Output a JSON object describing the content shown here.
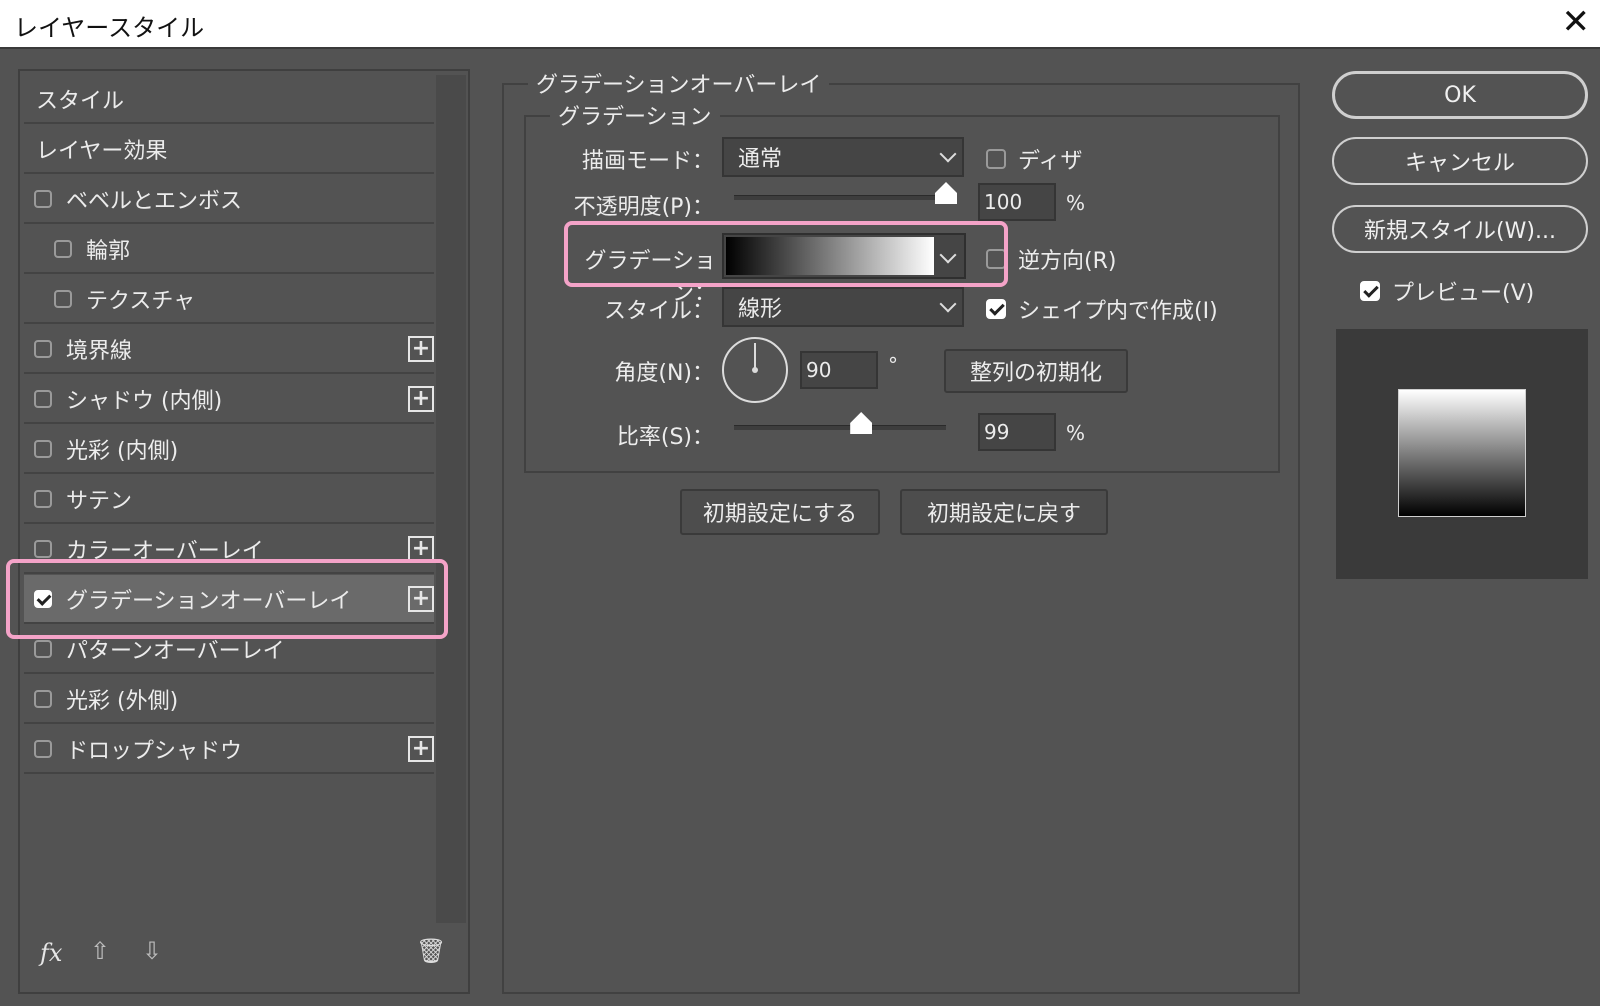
{
  "window": {
    "title": "レイヤースタイル",
    "close_glyph": "✕"
  },
  "left_panel": {
    "items": [
      {
        "label": "スタイル",
        "checkbox": null,
        "plus": false
      },
      {
        "label": "レイヤー効果",
        "checkbox": null,
        "plus": false
      },
      {
        "label": "ベベルとエンボス",
        "checkbox": false,
        "plus": false
      },
      {
        "label": "輪郭",
        "checkbox": false,
        "plus": false,
        "indent": true
      },
      {
        "label": "テクスチャ",
        "checkbox": false,
        "plus": false,
        "indent": true
      },
      {
        "label": "境界線",
        "checkbox": false,
        "plus": true
      },
      {
        "label": "シャドウ (内側)",
        "checkbox": false,
        "plus": true
      },
      {
        "label": "光彩 (内側)",
        "checkbox": false,
        "plus": false
      },
      {
        "label": "サテン",
        "checkbox": false,
        "plus": false
      },
      {
        "label": "カラーオーバーレイ",
        "checkbox": false,
        "plus": true
      },
      {
        "label": "グラデーションオーバーレイ",
        "checkbox": true,
        "plus": true,
        "selected": true
      },
      {
        "label": "パターンオーバーレイ",
        "checkbox": false,
        "plus": false
      },
      {
        "label": "光彩 (外側)",
        "checkbox": false,
        "plus": false
      },
      {
        "label": "ドロップシャドウ",
        "checkbox": false,
        "plus": true
      }
    ],
    "plus_glyph": "+",
    "bottom": {
      "fx": "fx",
      "up_glyph": "⇧",
      "down_glyph": "⇩",
      "trash_glyph": "🗑"
    }
  },
  "gradient_overlay": {
    "group_title": "グラデーションオーバーレイ",
    "sub_title": "グラデーション",
    "blend_mode": {
      "label": "描画モード：",
      "value": "通常"
    },
    "dither": {
      "label": "ディザ",
      "checked": false
    },
    "opacity": {
      "label": "不透明度(P)：",
      "value": "100",
      "unit": "%",
      "level": 1.0
    },
    "gradient": {
      "label": "グラデーション：",
      "from": "#000000",
      "to": "#ffffff"
    },
    "reverse": {
      "label": "逆方向(R)",
      "checked": false
    },
    "style": {
      "label": "スタイル：",
      "value": "線形"
    },
    "align_shape": {
      "label": "シェイプ内で作成(I)",
      "checked": true
    },
    "angle": {
      "label": "角度(N)：",
      "value": "90",
      "unit": "°",
      "reset_label": "整列の初期化"
    },
    "scale": {
      "label": "比率(S)：",
      "value": "99",
      "unit": "%",
      "level": 0.6
    },
    "buttons": {
      "make_default": "初期設定にする",
      "reset_default": "初期設定に戻す"
    }
  },
  "right_panel": {
    "ok": "OK",
    "cancel": "キャンセル",
    "new_style": "新規スタイル(W)...",
    "preview": {
      "label": "プレビュー(V)",
      "checked": true
    }
  },
  "colors": {
    "highlight": "#f4a3c8",
    "panel": "#535353"
  }
}
